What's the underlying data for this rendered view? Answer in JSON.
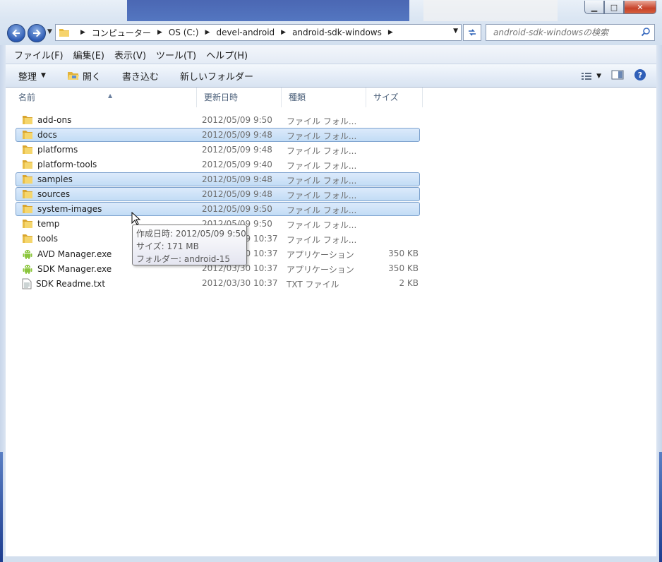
{
  "window": {
    "controls": {
      "minimize": "▁",
      "maximize": "□",
      "close": "✕"
    }
  },
  "nav": {
    "back_icon": "arrow-left-icon",
    "forward_icon": "arrow-right-icon"
  },
  "address": {
    "crumbs": [
      "コンピューター",
      "OS (C:)",
      "devel-android",
      "android-sdk-windows"
    ]
  },
  "search": {
    "placeholder": "android-sdk-windowsの検索"
  },
  "menu": {
    "file": "ファイル(F)",
    "edit": "編集(E)",
    "view": "表示(V)",
    "tools": "ツール(T)",
    "help": "ヘルプ(H)"
  },
  "toolbar": {
    "organize": "整理",
    "open": "開く",
    "burn": "書き込む",
    "new_folder": "新しいフォルダー"
  },
  "columns": {
    "name": "名前",
    "date": "更新日時",
    "type": "種類",
    "size": "サイズ"
  },
  "files": [
    {
      "name": "add-ons",
      "date": "2012/05/09 9:50",
      "type": "ファイル フォル...",
      "size": "",
      "icon": "folder-icon",
      "selected": false
    },
    {
      "name": "docs",
      "date": "2012/05/09 9:48",
      "type": "ファイル フォル...",
      "size": "",
      "icon": "folder-icon",
      "selected": true
    },
    {
      "name": "platforms",
      "date": "2012/05/09 9:48",
      "type": "ファイル フォル...",
      "size": "",
      "icon": "folder-icon",
      "selected": false
    },
    {
      "name": "platform-tools",
      "date": "2012/05/09 9:40",
      "type": "ファイル フォル...",
      "size": "",
      "icon": "folder-icon",
      "selected": false
    },
    {
      "name": "samples",
      "date": "2012/05/09 9:48",
      "type": "ファイル フォル...",
      "size": "",
      "icon": "folder-icon",
      "selected": true
    },
    {
      "name": "sources",
      "date": "2012/05/09 9:48",
      "type": "ファイル フォル...",
      "size": "",
      "icon": "folder-icon",
      "selected": true
    },
    {
      "name": "system-images",
      "date": "2012/05/09 9:50",
      "type": "ファイル フォル...",
      "size": "",
      "icon": "folder-icon",
      "selected": true
    },
    {
      "name": "temp",
      "date": "2012/05/09 9:50",
      "type": "ファイル フォル...",
      "size": "",
      "icon": "folder-icon",
      "selected": false
    },
    {
      "name": "tools",
      "date": "2012/05/09 10:37",
      "type": "ファイル フォル...",
      "size": "",
      "icon": "folder-icon",
      "selected": false
    },
    {
      "name": "AVD Manager.exe",
      "date": "2012/03/30 10:37",
      "type": "アプリケーション",
      "size": "350 KB",
      "icon": "android-icon",
      "selected": false
    },
    {
      "name": "SDK Manager.exe",
      "date": "2012/03/30 10:37",
      "type": "アプリケーション",
      "size": "350 KB",
      "icon": "android-icon",
      "selected": false
    },
    {
      "name": "SDK Readme.txt",
      "date": "2012/03/30 10:37",
      "type": "TXT ファイル",
      "size": "2 KB",
      "icon": "text-file-icon",
      "selected": false
    }
  ],
  "tooltip": {
    "created": "作成日時: 2012/05/09 9:50",
    "size": "サイズ: 171 MB",
    "folders": "フォルダー: android-15"
  }
}
